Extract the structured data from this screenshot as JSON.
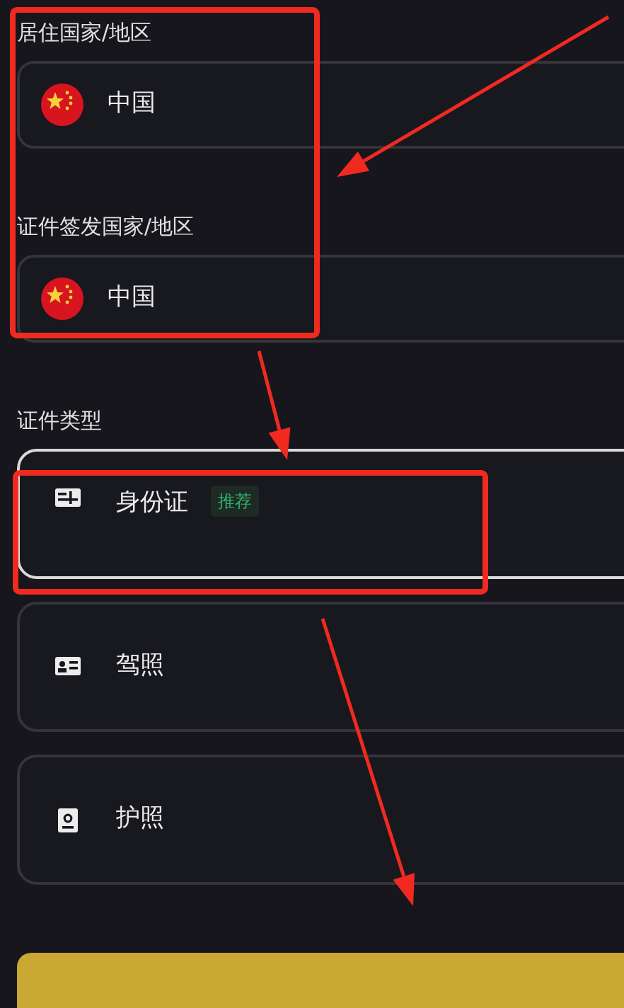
{
  "fields": [
    {
      "label": "居住国家/地区",
      "value": "中国"
    },
    {
      "label": "证件签发国家/地区",
      "value": "中国"
    }
  ],
  "document_type": {
    "label": "证件类型",
    "options": [
      {
        "kind": "id-card",
        "text": "身份证",
        "badge": "推荐",
        "selected": true
      },
      {
        "kind": "license",
        "text": "驾照",
        "selected": false
      },
      {
        "kind": "passport",
        "text": "护照",
        "selected": false
      }
    ]
  },
  "annotations": [
    {
      "kind": "box"
    },
    {
      "kind": "box"
    },
    {
      "kind": "arrow"
    },
    {
      "kind": "arrow"
    },
    {
      "kind": "arrow"
    }
  ]
}
